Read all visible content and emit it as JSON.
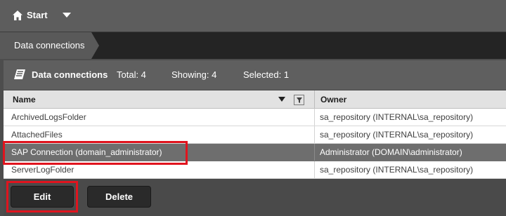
{
  "topbar": {
    "start_label": "Start",
    "home_icon": "home-icon",
    "menu_icon": "caret-down-icon"
  },
  "breadcrumb": {
    "current": "Data connections"
  },
  "panel": {
    "icon": "data-connection-icon",
    "title": "Data connections",
    "total": "Total: 4",
    "showing": "Showing: 4",
    "selected": "Selected: 1"
  },
  "table": {
    "columns": [
      "Name",
      "Owner"
    ],
    "rows": [
      {
        "name": "ArchivedLogsFolder",
        "owner": "sa_repository (INTERNAL\\sa_repository)",
        "selected": false
      },
      {
        "name": "AttachedFiles",
        "owner": "sa_repository (INTERNAL\\sa_repository)",
        "selected": false
      },
      {
        "name": "SAP Connection (domain_administrator)",
        "owner": "Administrator (DOMAIN\\administrator)",
        "selected": true
      },
      {
        "name": "ServerLogFolder",
        "owner": "sa_repository (INTERNAL\\sa_repository)",
        "selected": false
      }
    ]
  },
  "actions": {
    "edit_label": "Edit",
    "delete_label": "Delete"
  },
  "colors": {
    "highlight": "#e0141e",
    "selected_row": "#6e6e6e"
  }
}
